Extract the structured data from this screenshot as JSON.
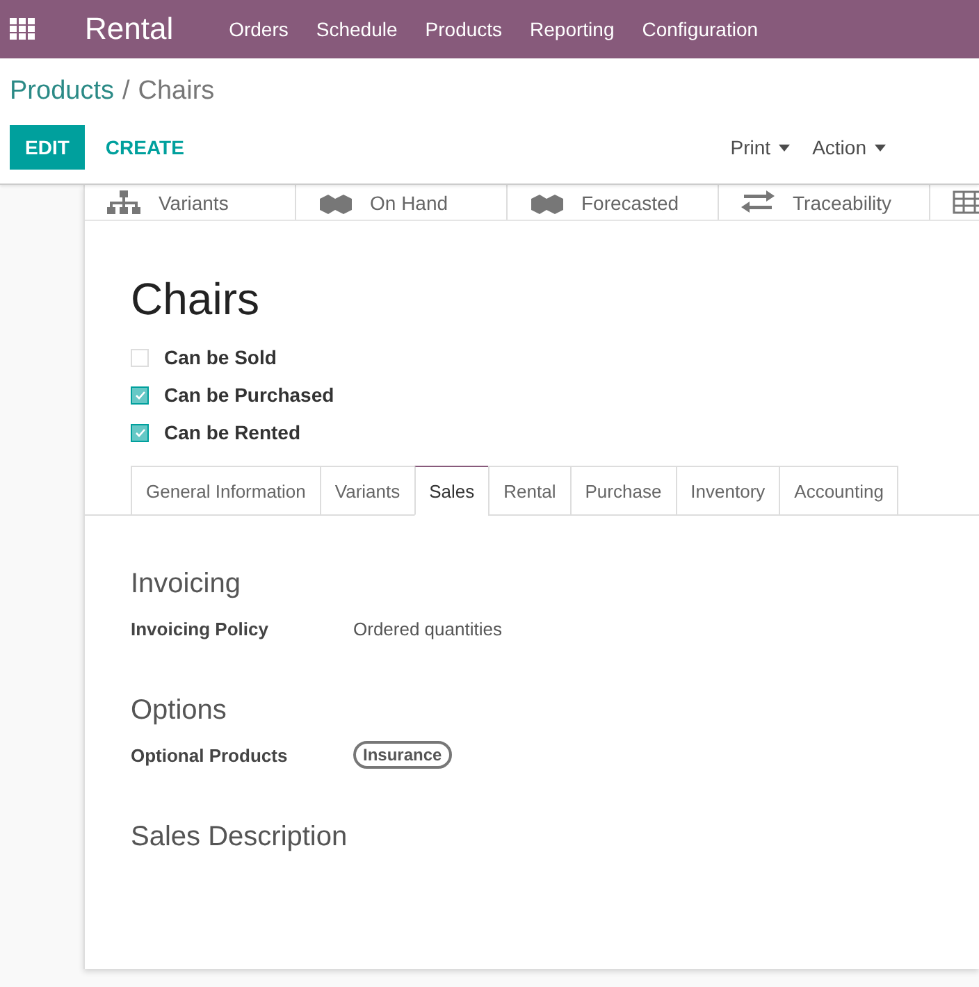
{
  "navbar": {
    "app": "Rental",
    "menu": [
      "Orders",
      "Schedule",
      "Products",
      "Reporting",
      "Configuration"
    ]
  },
  "breadcrumb": {
    "parent": "Products",
    "separator": "/",
    "current": "Chairs"
  },
  "buttons": {
    "edit": "EDIT",
    "create": "CREATE"
  },
  "dropdowns": [
    "Print",
    "Action"
  ],
  "stat_buttons": [
    {
      "kind": "variants",
      "label": "Variants"
    },
    {
      "kind": "cubes",
      "label": "On Hand"
    },
    {
      "kind": "cubes",
      "label": "Forecasted"
    },
    {
      "kind": "arrows",
      "label": "Traceability"
    },
    {
      "kind": "grid"
    }
  ],
  "product": {
    "name": "Chairs",
    "options": [
      {
        "label": "Can be Sold",
        "checked": false
      },
      {
        "label": "Can be Purchased",
        "checked": true
      },
      {
        "label": "Can be Rented",
        "checked": true
      }
    ]
  },
  "tabs": [
    {
      "label": "General Information",
      "selected": false
    },
    {
      "label": "Variants",
      "selected": false
    },
    {
      "label": "Sales",
      "selected": true
    },
    {
      "label": "Rental",
      "selected": false
    },
    {
      "label": "Purchase",
      "selected": false
    },
    {
      "label": "Inventory",
      "selected": false
    },
    {
      "label": "Accounting",
      "selected": false
    }
  ],
  "sections": [
    {
      "title": "Invoicing",
      "fields": [
        {
          "kind": "text",
          "label": "Invoicing Policy",
          "value": "Ordered quantities"
        }
      ]
    },
    {
      "title": "Options",
      "fields": [
        {
          "kind": "tag",
          "label": "Optional Products",
          "value": "Insurance"
        }
      ]
    },
    {
      "title": "Sales Description"
    }
  ]
}
